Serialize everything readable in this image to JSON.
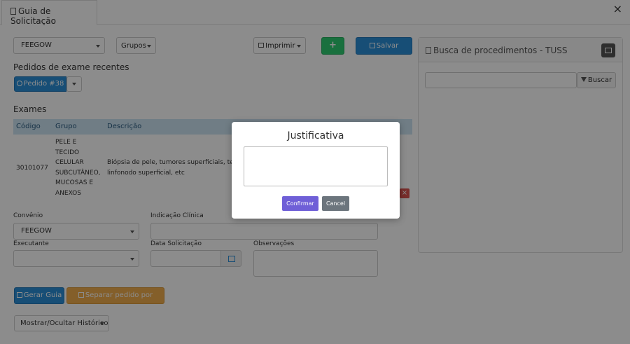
{
  "tab": {
    "label": "Guia de Solicitação",
    "close": "×"
  },
  "toolbar": {
    "convenio_select": "FEEGOW",
    "grupos_label": "Grupos",
    "imprimir_label": "Imprimir",
    "add_label": "+",
    "salvar_label": "Salvar"
  },
  "pedidos": {
    "heading": "Pedidos de exame recentes",
    "pedido_label": "Pedido #38"
  },
  "exames": {
    "heading": "Exames",
    "columns": [
      "Código",
      "Grupo",
      "Descrição"
    ],
    "rows": [
      {
        "codigo": "30101077",
        "grupo": [
          "PELE E",
          "TECIDO",
          "CELULAR",
          "SUBCUTÂNEO,",
          "MUCOSAS E",
          "ANEXOS"
        ],
        "descricao": [
          "Biópsia de pele, tumores superficiais, te",
          "linfonodo superficial, etc"
        ],
        "delete": "×"
      }
    ]
  },
  "form": {
    "convenio_label": "Convênio",
    "convenio_value": "FEEGOW",
    "indicacao_label": "Indicação Clínica",
    "executante_label": "Executante",
    "data_label": "Data Solicitação",
    "observacoes_label": "Observações"
  },
  "actions": {
    "gerar_guia": "Gerar Guia",
    "separar": "Separar pedido por grupo",
    "historico": "Mostrar/Ocultar Histórico"
  },
  "tuss": {
    "title": "Busca de procedimentos - TUSS",
    "buscar": "Buscar"
  },
  "modal": {
    "title": "Justificativa",
    "confirmar": "Confirmar",
    "cancel": "Cancel"
  }
}
